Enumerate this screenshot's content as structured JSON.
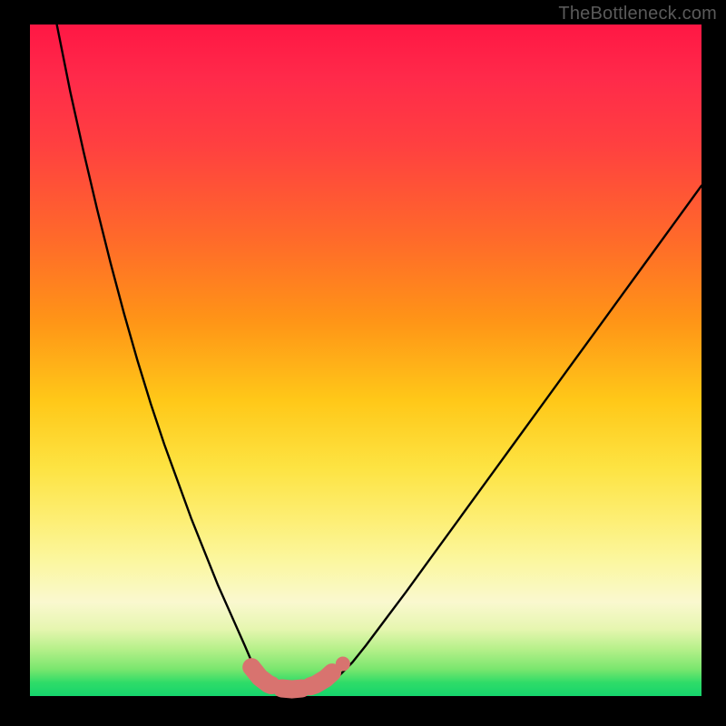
{
  "watermark": "TheBottleneck.com",
  "chart_data": {
    "type": "line",
    "title": "",
    "xlabel": "",
    "ylabel": "",
    "xlim": [
      0,
      100
    ],
    "ylim": [
      0,
      100
    ],
    "gradient_colors": {
      "top": "#ff1744",
      "mid_upper": "#ff9417",
      "mid": "#fde342",
      "mid_lower": "#faf8cf",
      "bottom": "#15d46c"
    },
    "series": [
      {
        "name": "left-curve",
        "stroke": "#000000",
        "x": [
          4,
          6,
          8,
          10,
          12,
          14,
          16,
          18,
          20,
          22,
          24,
          26,
          28,
          30,
          32,
          33.5,
          34.5
        ],
        "y": [
          100,
          90,
          81,
          72.5,
          64.5,
          57,
          50,
          43.5,
          37.5,
          32,
          26.5,
          21.5,
          16.5,
          12,
          7.5,
          4,
          2
        ]
      },
      {
        "name": "right-curve",
        "stroke": "#000000",
        "x": [
          45,
          46.5,
          48,
          50,
          53,
          56,
          60,
          64,
          68,
          72,
          76,
          80,
          84,
          88,
          92,
          96,
          100
        ],
        "y": [
          2,
          3.5,
          5,
          7.5,
          11.5,
          15.5,
          21,
          26.5,
          32,
          37.5,
          43,
          48.5,
          54,
          59.5,
          65,
          70.5,
          76
        ]
      },
      {
        "name": "bottom-segment",
        "stroke": "#d8736f",
        "x": [
          33,
          34.2,
          35.5,
          37,
          39,
          41,
          42.5,
          44,
          45
        ],
        "y": [
          4.3,
          2.8,
          1.8,
          1.2,
          1.0,
          1.2,
          1.7,
          2.6,
          3.5
        ]
      },
      {
        "name": "bottom-dot",
        "stroke": "#d8736f",
        "x": [
          46.6
        ],
        "y": [
          4.8
        ]
      }
    ],
    "annotations": []
  }
}
